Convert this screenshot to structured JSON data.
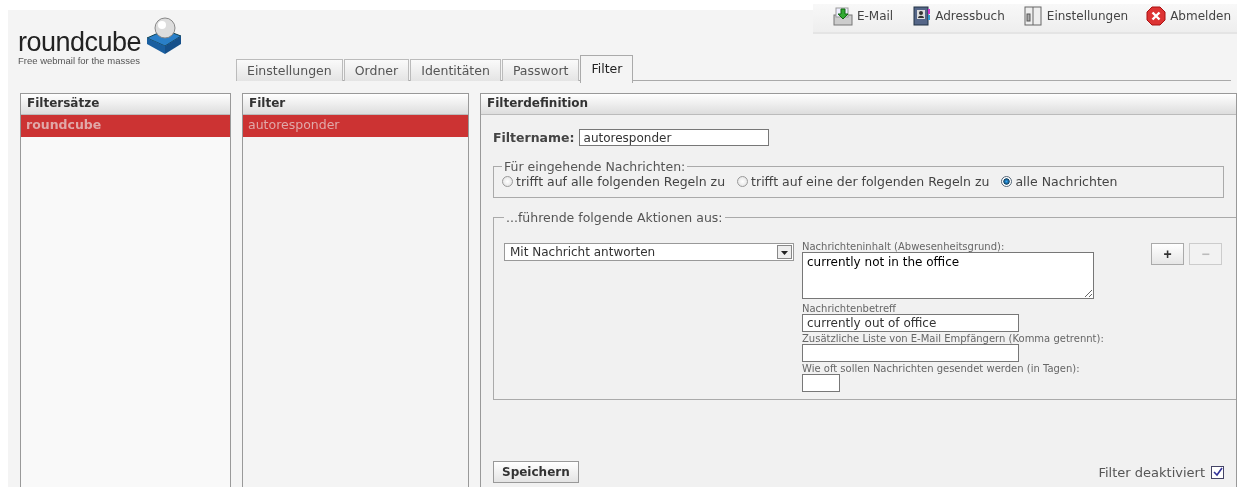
{
  "logo": {
    "wordmark": "roundcube",
    "tagline": "Free webmail for the masses"
  },
  "top_nav": [
    {
      "kind": "mail",
      "label": "E-Mail"
    },
    {
      "kind": "addressbook",
      "label": "Adressbuch"
    },
    {
      "kind": "settings",
      "label": "Einstellungen"
    },
    {
      "kind": "logout",
      "label": "Abmelden"
    }
  ],
  "tabs": [
    {
      "label": "Einstellungen",
      "selected": false
    },
    {
      "label": "Ordner",
      "selected": false
    },
    {
      "label": "Identitäten",
      "selected": false
    },
    {
      "label": "Passwort",
      "selected": false
    },
    {
      "label": "Filter",
      "selected": true
    }
  ],
  "filter_sets": {
    "title": "Filtersätze",
    "items": [
      {
        "label": "roundcube",
        "selected": true
      }
    ]
  },
  "filters": {
    "title": "Filter",
    "items": [
      {
        "label": "autoresponder",
        "selected": true
      }
    ]
  },
  "definition": {
    "title": "Filterdefinition",
    "name_label": "Filtername:",
    "name_value": "autoresponder",
    "match": {
      "legend": "Für eingehende Nachrichten:",
      "options": [
        {
          "label": "trifft auf alle folgenden Regeln zu",
          "selected": false
        },
        {
          "label": "trifft auf eine der folgenden Regeln zu",
          "selected": false
        },
        {
          "label": "alle Nachrichten",
          "selected": true
        }
      ]
    },
    "actions": {
      "legend": "...führende folgende Aktionen aus:",
      "action": "Mit Nachricht antworten",
      "fields": [
        {
          "kind": "textarea",
          "label": "Nachrichteninhalt (Abwesenheitsgrund):",
          "value": "currently not in the office"
        },
        {
          "kind": "input",
          "label": "Nachrichtenbetreff",
          "value": "currently out of office"
        },
        {
          "kind": "input",
          "label": "Zusätzliche Liste von E-Mail Empfängern (Komma getrennt):"
        },
        {
          "kind": "short",
          "label": "Wie oft sollen Nachrichten gesendet werden (in Tagen):"
        }
      ],
      "buttons": [
        {
          "label": "+",
          "disabled": false
        },
        {
          "label": "−",
          "disabled": true
        }
      ]
    },
    "save_button": "Speichern",
    "disable_toggle": {
      "label": "Filter deaktiviert",
      "checked": true
    }
  }
}
